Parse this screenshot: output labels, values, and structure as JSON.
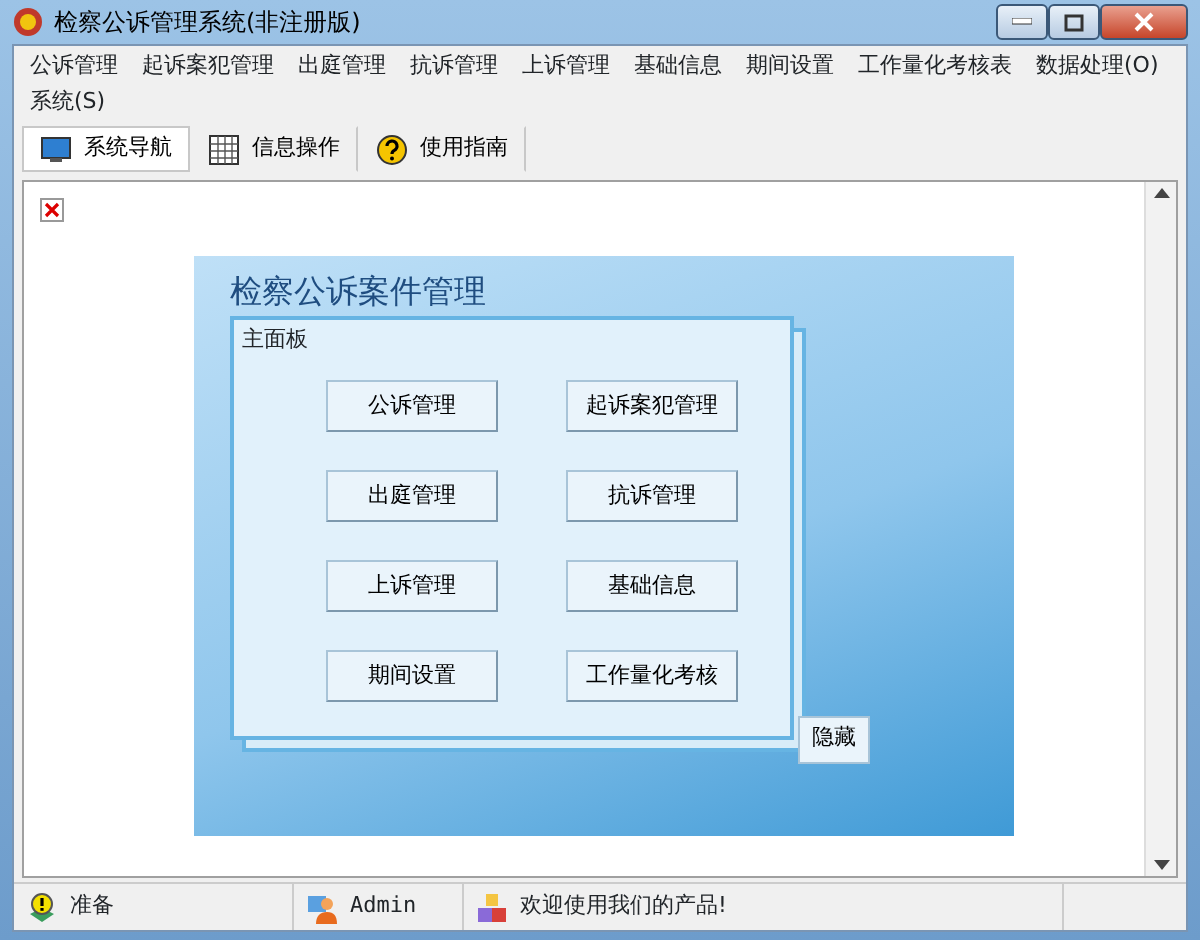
{
  "window": {
    "title": "检察公诉管理系统(非注册版)"
  },
  "menu": [
    "公诉管理",
    "起诉案犯管理",
    "出庭管理",
    "抗诉管理",
    "上诉管理",
    "基础信息",
    "期间设置",
    "工作量化考核表",
    "数据处理(O)",
    "系统(S)"
  ],
  "toolbar": [
    {
      "label": "系统导航",
      "kind": "monitor",
      "selected": true
    },
    {
      "label": "信息操作",
      "kind": "grid",
      "selected": false
    },
    {
      "label": "使用指南",
      "kind": "help",
      "selected": false
    }
  ],
  "panel": {
    "heading": "检察公诉案件管理",
    "group_title": "主面板",
    "buttons": [
      "公诉管理",
      "起诉案犯管理",
      "出庭管理",
      "抗诉管理",
      "上诉管理",
      "基础信息",
      "期间设置",
      "工作量化考核"
    ],
    "hide_button": "隐藏"
  },
  "status_bar": [
    {
      "text": "准备",
      "kind": "ready"
    },
    {
      "text": "Admin",
      "kind": "user"
    },
    {
      "text": "欢迎使用我们的产品!",
      "kind": "cubes"
    }
  ]
}
